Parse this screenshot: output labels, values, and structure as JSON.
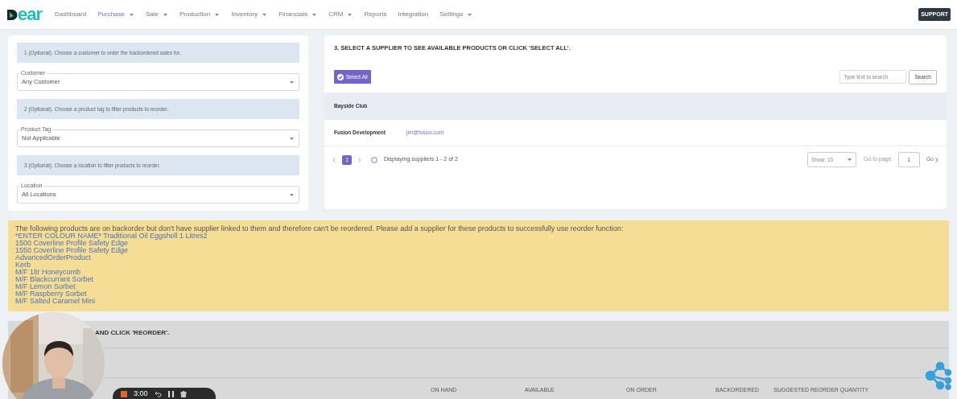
{
  "nav": {
    "logo": "ear",
    "items": [
      {
        "label": "Dashboard",
        "dropdown": false,
        "selected": false
      },
      {
        "label": "Purchase",
        "dropdown": true,
        "selected": true
      },
      {
        "label": "Sale",
        "dropdown": true,
        "selected": false
      },
      {
        "label": "Production",
        "dropdown": true,
        "selected": false
      },
      {
        "label": "Inventory",
        "dropdown": true,
        "selected": false
      },
      {
        "label": "Financials",
        "dropdown": true,
        "selected": false
      },
      {
        "label": "CRM",
        "dropdown": true,
        "selected": false
      },
      {
        "label": "Reports",
        "dropdown": false,
        "selected": false
      },
      {
        "label": "Integration",
        "dropdown": false,
        "selected": false
      },
      {
        "label": "Settings",
        "dropdown": true,
        "selected": false
      }
    ],
    "support": "SUPPORT"
  },
  "filters": [
    {
      "hint": "1 (Optional). Choose a customer to order the backordered sales for.",
      "label": "Customer",
      "value": "Any Customer"
    },
    {
      "hint": "2 (Optional). Choose a product tag to filter products to reorder.",
      "label": "Product Tag",
      "value": "Not Applicable"
    },
    {
      "hint": "3 (Optional). Choose a location to filter products to reorder.",
      "label": "Location",
      "value": "All Locations"
    }
  ],
  "suppliers": {
    "title": "3. SELECT A SUPPLIER TO SEE AVAILABLE PRODUCTS OR CLICK 'SELECT ALL'.",
    "select_all": "Select All",
    "search": {
      "placeholder": "Type text to search",
      "button": "Search"
    },
    "rows": [
      {
        "name": "Bayside Club",
        "email": null,
        "selected": true
      },
      {
        "name": "Fusion Development",
        "email": "jim@fusion.com",
        "selected": false
      }
    ],
    "pages": [
      {
        "label": "1",
        "selected": true
      }
    ],
    "display": "Displaying suppliers 1 - 2 of 2",
    "show": "Show: 10",
    "goto_label": "Go to page",
    "goto_value": "1",
    "go": "Go"
  },
  "warning": {
    "message": "The following products are on backorder but don't have supplier linked to them and therefore can't be reordered. Please add a supplier for these products to successfully use reorder function:",
    "products": [
      "*ENTER COLOUR NAME* Traditional Oil Eggshell 1 Litres2",
      "1500 Coverline Profile Safety Edge",
      "1550 Coverline Profile Safety Edge",
      "AdvancedOrderProduct",
      "Kerb",
      "M/F 1ltr Honeycomb",
      "M/F Blackcurrant Sorbet",
      "M/F Lemon Sorbet",
      "M/F Raspberry Sorbet",
      "M/F Salted Caramel Mini"
    ]
  },
  "reorder": {
    "title": "AND CLICK 'REORDER'.",
    "columns": [
      "ON HAND",
      "AVAILABLE",
      "ON ORDER",
      "BACKORDERED",
      "SUGGESTED REORDER QUANTITY"
    ]
  },
  "recorder": {
    "time": "3:00"
  }
}
